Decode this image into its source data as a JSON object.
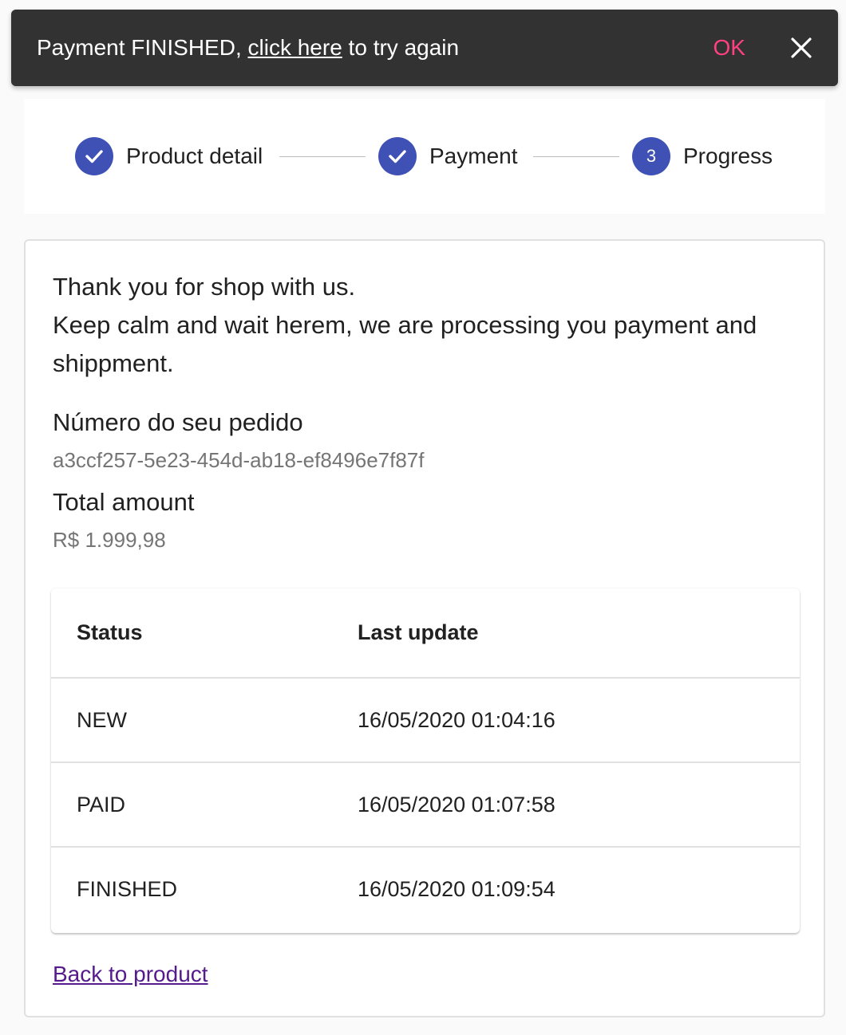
{
  "snackbar": {
    "prefix": "Payment FINISHED, ",
    "link_text": "click here",
    "suffix": " to try again",
    "ok_label": "OK",
    "close_icon": "close-icon",
    "accent_color": "#ff4081"
  },
  "stepper": {
    "steps": [
      {
        "label": "Product detail",
        "state": "completed",
        "icon": "check-icon"
      },
      {
        "label": "Payment",
        "state": "completed",
        "icon": "check-icon"
      },
      {
        "label": "Progress",
        "state": "active",
        "number": "3"
      }
    ],
    "color": "#3f51b5"
  },
  "order": {
    "intro_line1": "Thank you for shop with us.",
    "intro_line2": "Keep calm and wait herem, we are processing you payment and shippment.",
    "order_number_label": "Número do seu pedido",
    "order_number": "a3ccf257-5e23-454d-ab18-ef8496e7f87f",
    "total_label": "Total amount",
    "total_value": "R$ 1.999,98"
  },
  "status_table": {
    "headers": [
      "Status",
      "Last update"
    ],
    "rows": [
      [
        "NEW",
        "16/05/2020 01:04:16"
      ],
      [
        "PAID",
        "16/05/2020 01:07:58"
      ],
      [
        "FINISHED",
        "16/05/2020 01:09:54"
      ]
    ]
  },
  "back_link": "Back to product"
}
